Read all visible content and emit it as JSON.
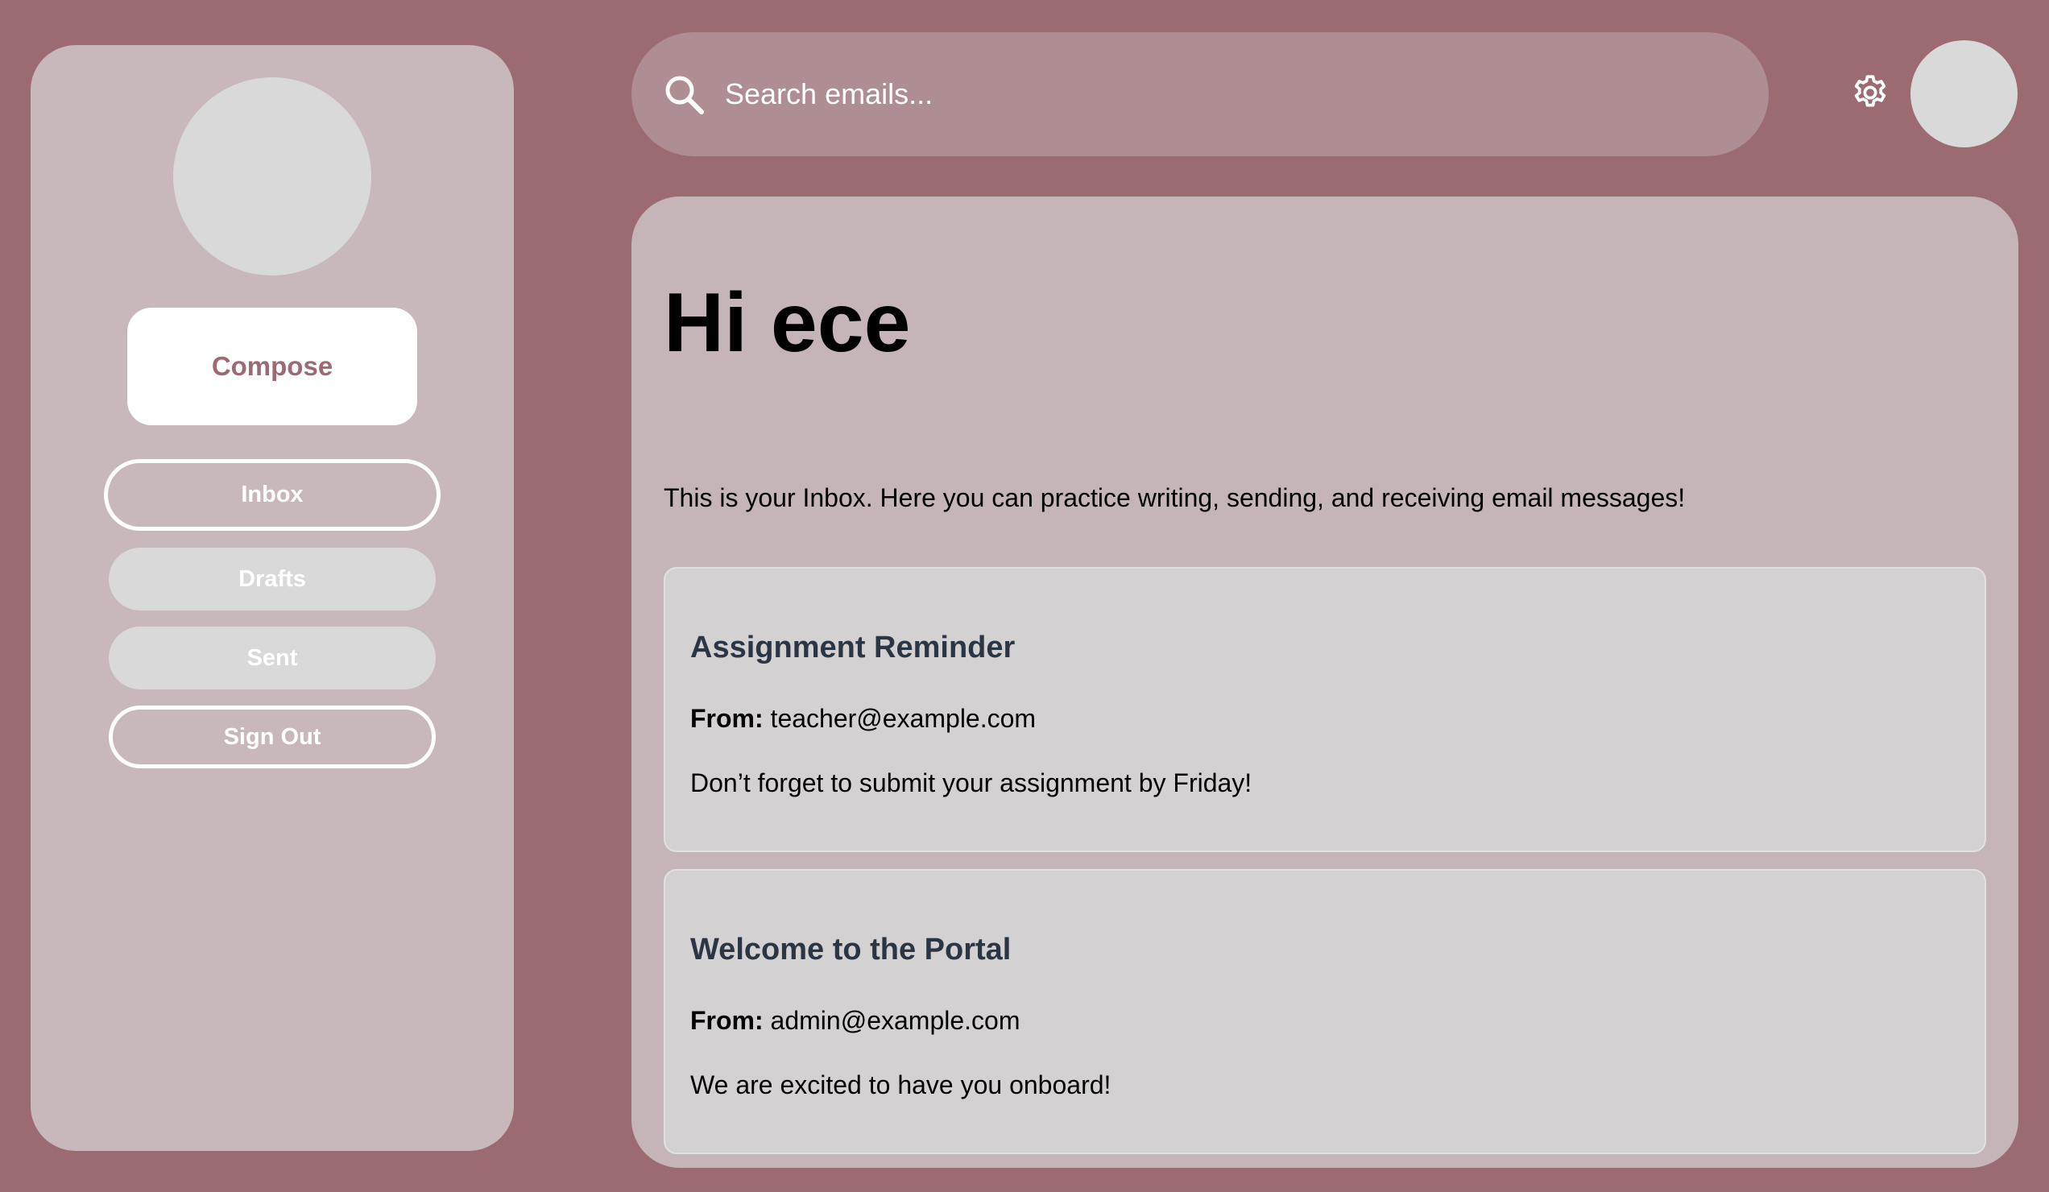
{
  "colors": {
    "background": "#9b6b71",
    "sidebar": "#c9b8bb",
    "panel": "#c6b5b8",
    "card": "#d3d1d2",
    "accent": "#9b6b71",
    "subject": "#2b3544",
    "avatar_placeholder": "#d9d9d9"
  },
  "sidebar": {
    "compose_label": "Compose",
    "nav": [
      {
        "label": "Inbox",
        "style": "outline",
        "active": true
      },
      {
        "label": "Drafts",
        "style": "filled"
      },
      {
        "label": "Sent",
        "style": "filled"
      },
      {
        "label": "Sign Out",
        "style": "outline"
      }
    ]
  },
  "search": {
    "placeholder": "Search emails...",
    "value": "",
    "icon": "search-icon"
  },
  "header": {
    "settings_icon": "gear-icon"
  },
  "main": {
    "greeting": "Hi ece",
    "intro": "This is your Inbox. Here you can practice writing, sending, and receiving email messages!",
    "from_label": "From:",
    "emails": [
      {
        "subject": "Assignment Reminder",
        "from": "teacher@example.com",
        "body": "Don’t forget to submit your assignment by Friday!"
      },
      {
        "subject": "Welcome to the Portal",
        "from": "admin@example.com",
        "body": "We are excited to have you onboard!"
      }
    ]
  }
}
